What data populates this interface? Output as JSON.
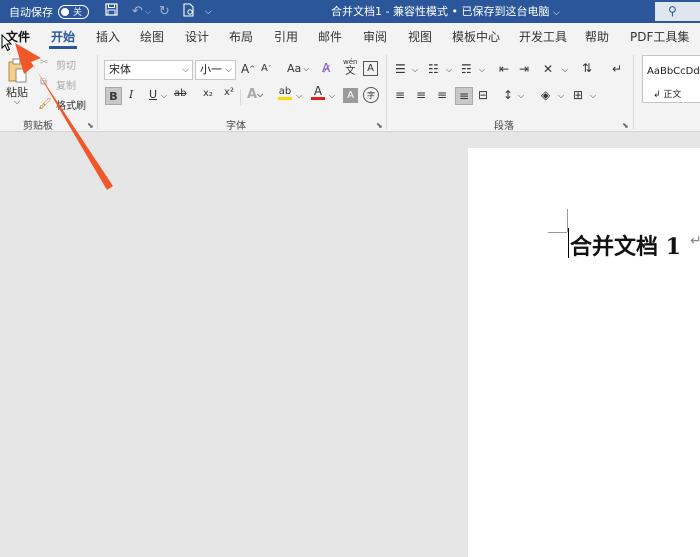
{
  "titlebar": {
    "autosave_label": "自动保存",
    "toggle_label": "关",
    "doc_title": "合并文档1  -  兼容性模式 • 已保存到这台电脑",
    "title_chevron": "⌵",
    "search_icon": "⚲"
  },
  "tabs": {
    "file": "文件",
    "home": "开始",
    "insert": "插入",
    "draw": "绘图",
    "design": "设计",
    "layout": "布局",
    "references": "引用",
    "mailings": "邮件",
    "review": "审阅",
    "view": "视图",
    "template": "模板中心",
    "developer": "开发工具",
    "help": "帮助",
    "pdf": "PDF工具集"
  },
  "clipboard": {
    "paste": "粘贴",
    "cut": "剪切",
    "copy": "复制",
    "format_painter": "格式刷",
    "group_label": "剪贴板"
  },
  "font": {
    "font_name": "宋体",
    "font_size": "小一",
    "grow": "A",
    "shrink": "A",
    "case": "Aa",
    "phonetic_top": "wén",
    "phonetic_bottom": "文",
    "border_char": "A",
    "bold": "B",
    "italic": "I",
    "underline": "U",
    "strike": "ab",
    "subscript": "x₂",
    "superscript": "x²",
    "text_effect": "A",
    "highlight": "ab",
    "font_color": "A",
    "shading": "A",
    "enclose": "字",
    "group_label": "字体"
  },
  "paragraph": {
    "group_label": "段落"
  },
  "styles": {
    "sample": "AaBbCcDd",
    "name": "正文"
  },
  "document": {
    "heading": "合并文档 1",
    "para_mark": "↵"
  },
  "colors": {
    "title_bar": "#2b579a",
    "accent": "#2b579a",
    "arrow": "#f0582a",
    "highlight": "#ffd800",
    "font_color": "#e02020"
  }
}
